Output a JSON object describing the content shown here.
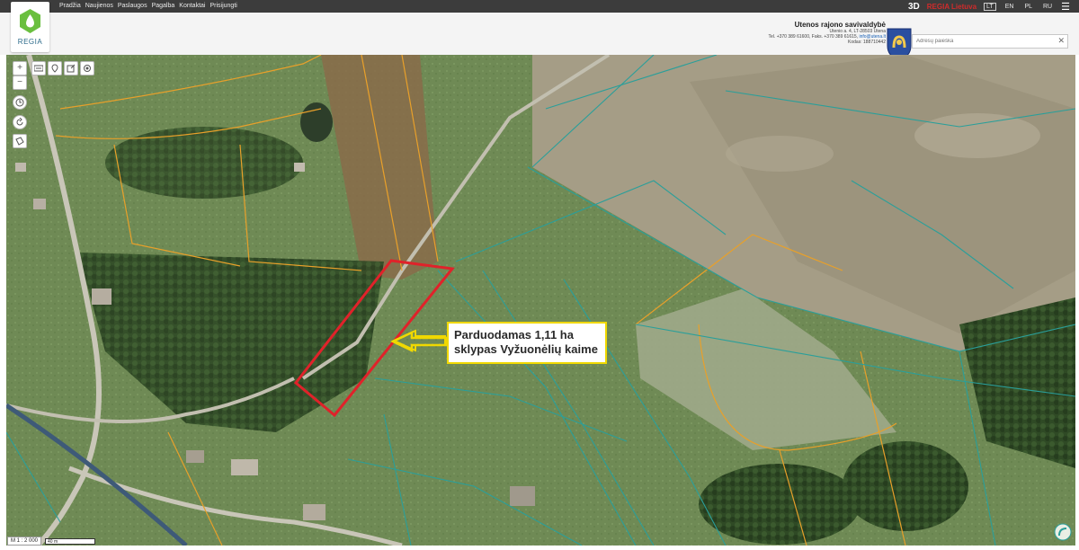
{
  "nav": {
    "links": [
      "Pradžia",
      "Naujienos",
      "Paslaugos",
      "Pagalba",
      "Kontaktai",
      "Prisijungti"
    ],
    "btn_3d": "3D",
    "regia_lietuva": "REGIA Lietuva",
    "languages": [
      "LT",
      "EN",
      "PL",
      "RU"
    ],
    "active_language": "LT",
    "menu_icon": "hamburger-icon"
  },
  "logo": {
    "text": "REGIA",
    "color": "#6abf3f"
  },
  "municipality": {
    "name": "Utenos rajono savivaldybė",
    "address": "Utenio a. 4, LT-28503 Utena",
    "contacts_prefix": "Tel. +370 389 61600, Faks. +370 389 61615, ",
    "email": "info@utena.lt",
    "code": "Kodas: 188710442"
  },
  "search": {
    "placeholder": "Adresų paieška",
    "clear_icon": "close-icon"
  },
  "map_tools": {
    "zoom_in": "+",
    "zoom_out": "−",
    "icons": [
      "zoom-in-icon",
      "zoom-out-icon",
      "layers-icon",
      "pin-icon",
      "edit-icon",
      "locate-icon",
      "history-icon",
      "refresh-icon",
      "measure-icon"
    ]
  },
  "annotation": {
    "line1": "Parduodamas 1,11 ha",
    "line2": "sklypas Vyžuonėlių kaime",
    "border_color": "#f0d800",
    "arrow_color": "#f0d800",
    "plot_color": "#e0222a"
  },
  "scale": {
    "ratio": "M 1 : 2 000",
    "bar": "40 m"
  },
  "colors": {
    "parcel_orange": "#e8a02a",
    "parcel_teal": "#2a9f9a",
    "topbar": "#3c3c3c"
  }
}
